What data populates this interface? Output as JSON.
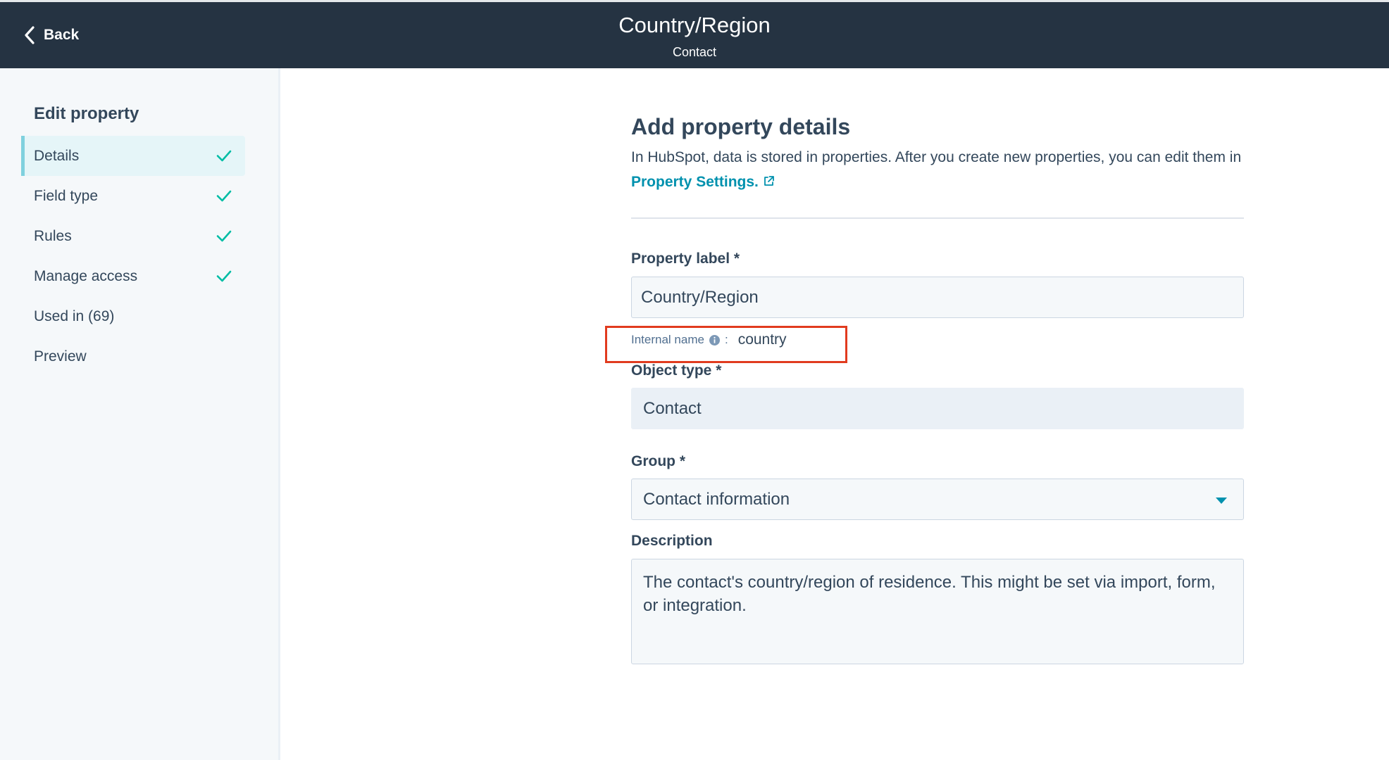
{
  "header": {
    "back_label": "Back",
    "title": "Country/Region",
    "subtitle": "Contact"
  },
  "sidebar": {
    "heading": "Edit property",
    "items": [
      {
        "label": "Details",
        "checked": true,
        "active": true
      },
      {
        "label": "Field type",
        "checked": true,
        "active": false
      },
      {
        "label": "Rules",
        "checked": true,
        "active": false
      },
      {
        "label": "Manage access",
        "checked": true,
        "active": false
      },
      {
        "label": "Used in (69)",
        "checked": false,
        "active": false
      },
      {
        "label": "Preview",
        "checked": false,
        "active": false
      }
    ]
  },
  "form": {
    "title": "Add property details",
    "intro_text": "In HubSpot, data is stored in properties. After you create new properties, you can edit them in ",
    "intro_link": "Property Settings.",
    "property_label": {
      "label": "Property label *",
      "value": "Country/Region"
    },
    "internal_name": {
      "label": "Internal name",
      "colon": ":",
      "value": "country"
    },
    "object_type": {
      "label": "Object type *",
      "value": "Contact"
    },
    "group": {
      "label": "Group *",
      "value": "Contact information"
    },
    "description": {
      "label": "Description",
      "value": "The contact's country/region of residence. This might be set via import, form, or integration."
    }
  },
  "colors": {
    "header_bg": "#253342",
    "accent": "#0091ae",
    "check": "#00bda5",
    "highlight": "#e13b1f"
  },
  "icons": [
    "chevron-left-icon",
    "check-icon",
    "external-link-icon",
    "info-icon",
    "caret-down-icon"
  ]
}
